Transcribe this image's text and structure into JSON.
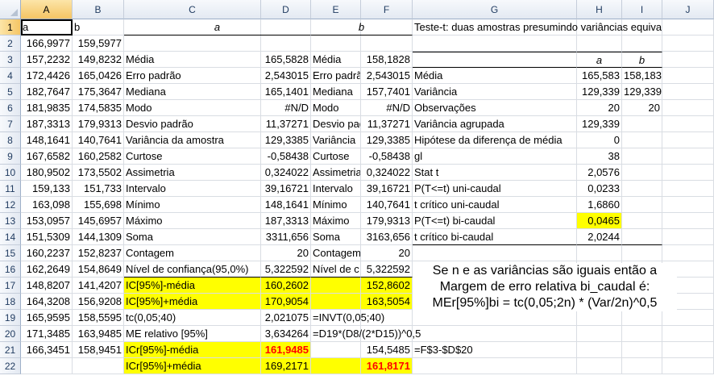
{
  "columns": [
    "A",
    "B",
    "C",
    "D",
    "E",
    "F",
    "G",
    "H",
    "I",
    "J"
  ],
  "rows": [
    "1",
    "2",
    "3",
    "4",
    "5",
    "6",
    "7",
    "8",
    "9",
    "10",
    "11",
    "12",
    "13",
    "14",
    "15",
    "16",
    "17",
    "18",
    "19",
    "20",
    "21",
    "22"
  ],
  "colA": [
    "a",
    "166,9977",
    "157,2232",
    "172,4426",
    "182,7647",
    "181,9835",
    "187,3313",
    "148,1641",
    "167,6582",
    "180,9502",
    "159,133",
    "163,098",
    "153,0957",
    "151,5309",
    "160,2237",
    "162,2649",
    "148,8207",
    "164,3208",
    "165,9595",
    "171,3485",
    "166,3451",
    ""
  ],
  "colB": [
    "b",
    "159,5977",
    "149,8232",
    "165,0426",
    "175,3647",
    "174,5835",
    "179,9313",
    "140,7641",
    "160,2582",
    "173,5502",
    "151,733",
    "155,698",
    "145,6957",
    "144,1309",
    "152,8237",
    "154,8649",
    "141,4207",
    "156,9208",
    "158,5595",
    "163,9485",
    "158,9451",
    ""
  ],
  "C1": "a",
  "E1": "b",
  "stats_labels": [
    "Média",
    "Erro padrão",
    "Mediana",
    "Modo",
    "Desvio padrão",
    "Variância da amostra",
    "Curtose",
    "Assimetria",
    "Intervalo",
    "Mínimo",
    "Máximo",
    "Soma",
    "Contagem",
    "Nível de confiança(95,0%)"
  ],
  "stats_a": [
    "165,5828",
    "2,543015",
    "165,1401",
    "#N/D",
    "11,37271",
    "129,3385",
    "-0,58438",
    "0,324022",
    "39,16721",
    "148,1641",
    "187,3313",
    "3311,656",
    "20",
    "5,322592"
  ],
  "stats_labels_b": [
    "Média",
    "Erro padrão",
    "Mediana",
    "Modo",
    "Desvio padrão",
    "Variância",
    "Curtose",
    "Assimetria",
    "Intervalo",
    "Mínimo",
    "Máximo",
    "Soma",
    "Contagem",
    "Nível de c"
  ],
  "stats_b": [
    "158,1828",
    "2,543015",
    "157,7401",
    "#N/D",
    "11,37271",
    "129,3385",
    "-0,58438",
    "0,324022",
    "39,16721",
    "140,7641",
    "179,9313",
    "3163,656",
    "20",
    "5,322592"
  ],
  "C17": "IC[95%]-média",
  "D17": "160,2602",
  "F17": "152,8602",
  "C18": "IC[95%]+média",
  "D18": "170,9054",
  "F18": "163,5054",
  "C19": "tc(0,05;40)",
  "D19": "2,021075",
  "E19": "=INVT(0,05;40)",
  "C20": "ME relativo [95%]",
  "D20": "3,634264",
  "E20": "=D19*(D8/(2*D15))^0,5",
  "C21": "ICr[95%]-média",
  "D21": "161,9485",
  "F21": "154,5485",
  "G21": "=F$3-$D$20",
  "C22": "ICr[95%]+média",
  "D22": "169,2171",
  "F22": "161,8171",
  "ttest": {
    "title": "Teste-t: duas amostras presumindo variâncias equivalentes",
    "hdr_a": "a",
    "hdr_b": "b",
    "labels": [
      "Média",
      "Variância",
      "Observações",
      "Variância agrupada",
      "Hipótese da diferença de média",
      "gl",
      "Stat t",
      "P(T<=t) uni-caudal",
      "t crítico uni-caudal",
      "P(T<=t) bi-caudal",
      "t crítico bi-caudal"
    ],
    "h": [
      "165,583",
      "129,339",
      "20",
      "129,339",
      "0",
      "38",
      "2,0576",
      "0,0233",
      "1,6860",
      "0,0465",
      "2,0244"
    ],
    "i": [
      "158,183",
      "129,339",
      "20",
      "",
      "",
      "",
      "",
      "",
      "",
      "",
      ""
    ]
  },
  "note": {
    "line1": "Se n e as variâncias são iguais então a",
    "line2": "Margem de erro relativa bi_caudal é:",
    "line3": "MEr[95%]bi = tc(0,05;2n) * (Var/2n)^0,5"
  }
}
